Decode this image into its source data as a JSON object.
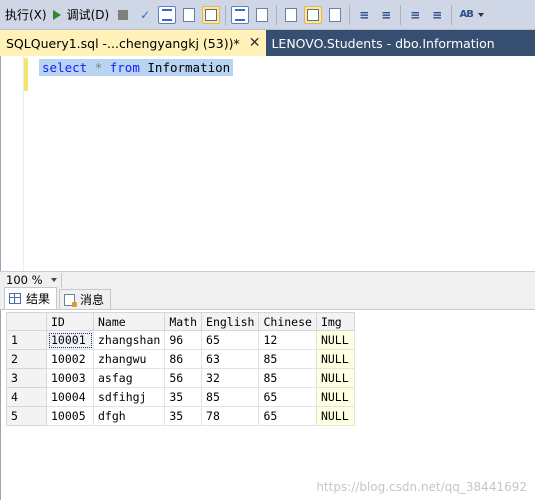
{
  "toolbar": {
    "execute_label": "执行(X)",
    "debug_label": "调试(D)"
  },
  "tabs": {
    "active": "SQLQuery1.sql -...chengyangkj (53))*",
    "close": "✕",
    "inactive": "LENOVO.Students - dbo.Information"
  },
  "editor": {
    "kw_select": "select",
    "star": "*",
    "kw_from": "from",
    "table": "Information"
  },
  "zoom": {
    "level": "100 %"
  },
  "results_tabs": {
    "results_label": "结果",
    "messages_label": "消息"
  },
  "grid": {
    "columns": [
      "ID",
      "Name",
      "Math",
      "English",
      "Chinese",
      "Img"
    ],
    "rows": [
      {
        "n": "1",
        "id": "10001",
        "name": "zhangshan",
        "math": "96",
        "english": "65",
        "chinese": "12",
        "img": "NULL"
      },
      {
        "n": "2",
        "id": "10002",
        "name": "zhangwu",
        "math": "86",
        "english": "63",
        "chinese": "85",
        "img": "NULL"
      },
      {
        "n": "3",
        "id": "10003",
        "name": "asfag",
        "math": "56",
        "english": "32",
        "chinese": "85",
        "img": "NULL"
      },
      {
        "n": "4",
        "id": "10004",
        "name": "sdfihgj",
        "math": "35",
        "english": "85",
        "chinese": "65",
        "img": "NULL"
      },
      {
        "n": "5",
        "id": "10005",
        "name": "dfgh",
        "math": "35",
        "english": "78",
        "chinese": "65",
        "img": "NULL"
      }
    ]
  },
  "watermark": "https://blog.csdn.net/qq_38441692",
  "colors": {
    "tab_active": "#fff1b8",
    "tab_bar": "#364e6f",
    "keyword": "#1a1aff",
    "selection": "#b7d4f3",
    "null_cell": "#ffffe1"
  }
}
